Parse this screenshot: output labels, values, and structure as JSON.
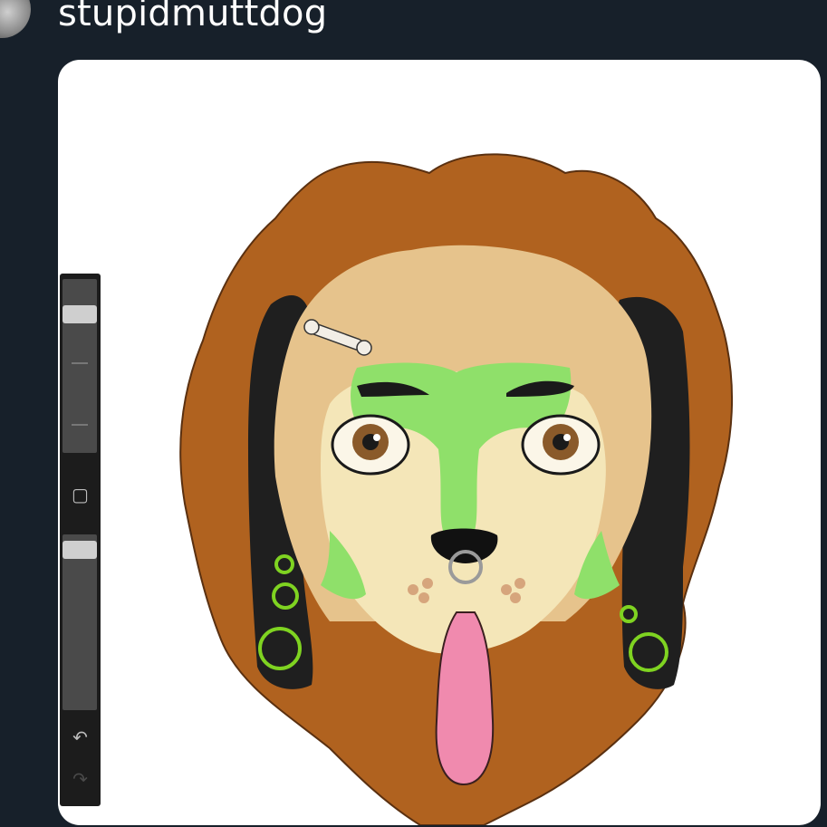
{
  "post": {
    "username": "stupidmuttdog"
  },
  "toolbar": {
    "brush_size_level": 0.17,
    "opacity_level": 0.04,
    "icons": [
      "square-modify-icon",
      "undo-icon",
      "redo-icon"
    ]
  },
  "colors": {
    "background": "#17202a",
    "fur_brown": "#b0621f",
    "fur_light": "#e6c38c",
    "face_cream": "#f4e6b8",
    "mask_green": "#8fe06a",
    "ear_black": "#1f1f1f",
    "tongue_pink": "#f08aae",
    "ring_green": "#7fd321"
  }
}
